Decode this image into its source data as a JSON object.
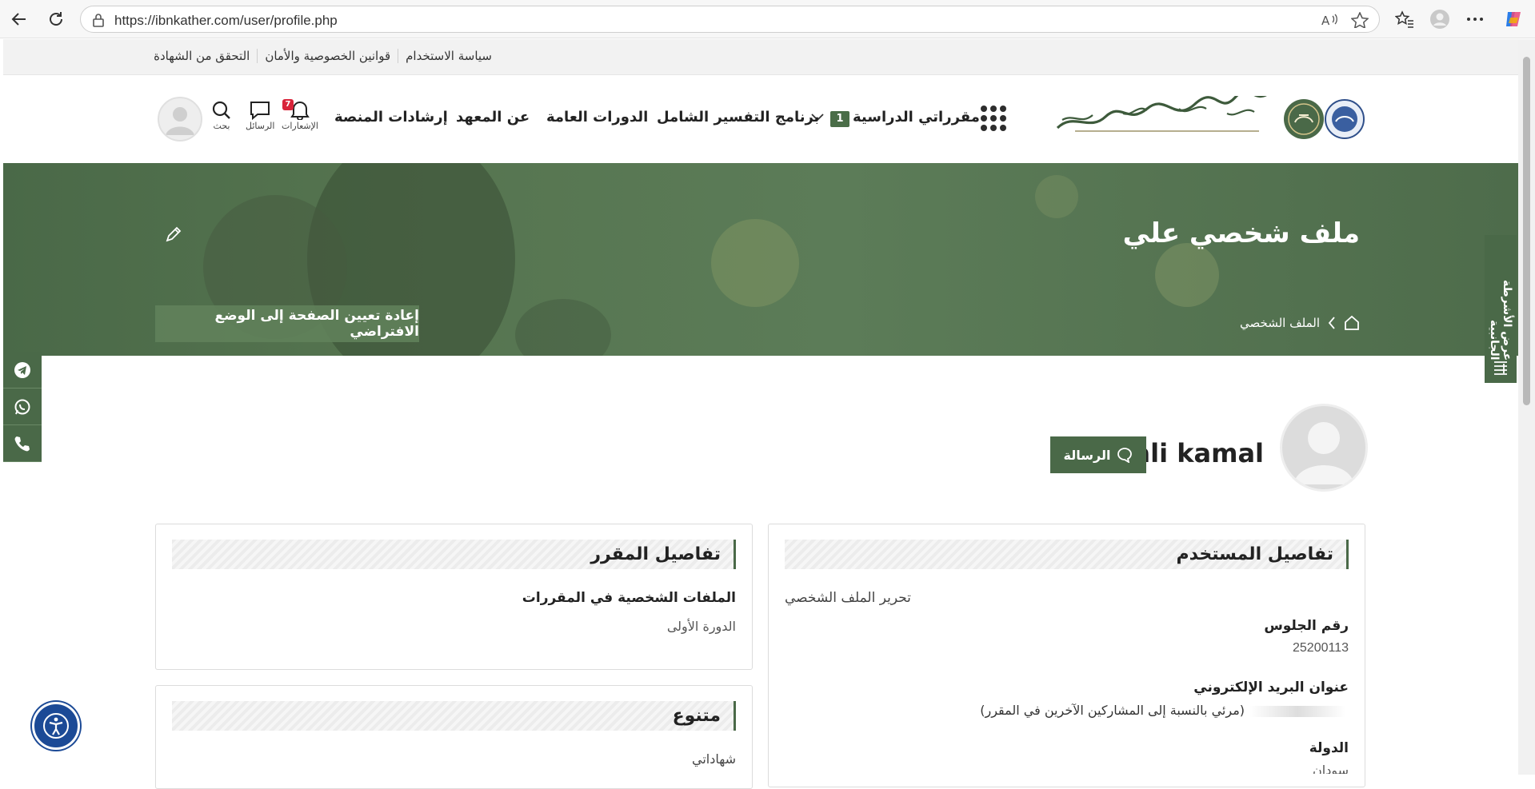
{
  "browser": {
    "url": "https://ibnkather.com/user/profile.php"
  },
  "utility_links": [
    "سياسة الاستخدام",
    "قوانين الخصوصية والأمان",
    "التحقق من الشهادة"
  ],
  "header": {
    "nav": {
      "my_courses": "مقرراتي الدراسية",
      "my_courses_count": "1",
      "program": "برنامج التفسير الشامل",
      "general_courses": "الدورات العامة",
      "about": "عن المعهد",
      "guides": "إرشادات المنصة"
    },
    "icons": {
      "notifications": "الإشعارات",
      "notifications_count": "7",
      "messages": "الرسائل",
      "search": "بحث"
    }
  },
  "hero": {
    "title": "ملف شخصي علي",
    "breadcrumb": "الملف الشخصي",
    "reset_button": "إعادة تعيين الصفحة إلى الوضع الافتراضي"
  },
  "drawer": {
    "label": "عرض الأشرطة الجانبية"
  },
  "profile": {
    "name": "ali kamal",
    "message_button": "الرسالة"
  },
  "user_details": {
    "title": "تفاصيل المستخدم",
    "edit_link": "تحرير الملف الشخصي",
    "seat_label": "رقم الجلوس",
    "seat_value": "25200113",
    "email_label": "عنوان البريد الإلكتروني",
    "email_note": "(مرئي بالنسبة إلى المشاركين الآخرين في المقرر)",
    "country_label": "الدولة",
    "country_value": "سودان"
  },
  "course_details": {
    "title": "تفاصيل المقرر",
    "profiles_label": "الملفات الشخصية في المقررات",
    "first_course": "الدورة الأولى"
  },
  "misc": {
    "title": "متنوع",
    "certificates": "شهاداتي"
  },
  "colors": {
    "brand_green": "#4a6948",
    "notification_red": "#d9243a",
    "accessibility_blue": "#1c4a96"
  }
}
